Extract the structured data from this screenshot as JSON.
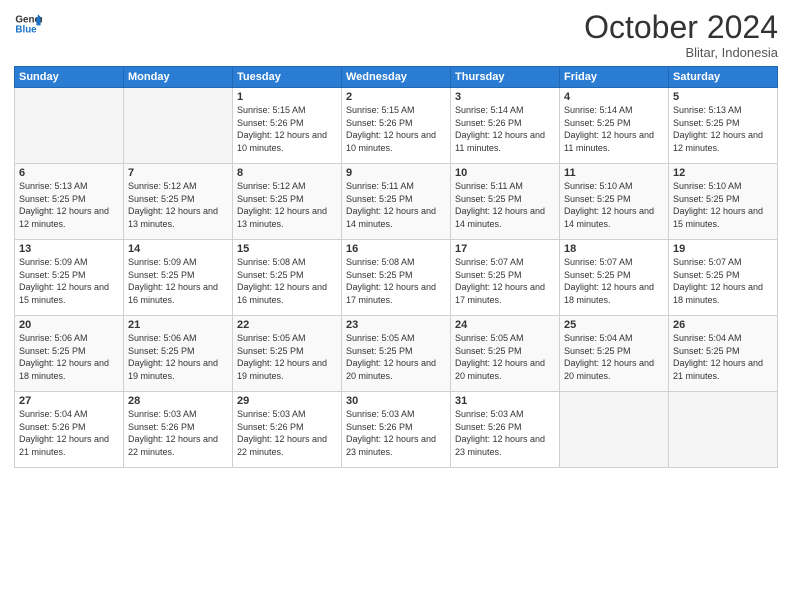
{
  "header": {
    "logo_line1": "General",
    "logo_line2": "Blue",
    "month": "October 2024",
    "location": "Blitar, Indonesia"
  },
  "weekdays": [
    "Sunday",
    "Monday",
    "Tuesday",
    "Wednesday",
    "Thursday",
    "Friday",
    "Saturday"
  ],
  "weeks": [
    [
      {
        "day": "",
        "empty": true
      },
      {
        "day": "",
        "empty": true
      },
      {
        "day": "1",
        "sunrise": "5:15 AM",
        "sunset": "5:26 PM",
        "daylight": "12 hours and 10 minutes."
      },
      {
        "day": "2",
        "sunrise": "5:15 AM",
        "sunset": "5:26 PM",
        "daylight": "12 hours and 10 minutes."
      },
      {
        "day": "3",
        "sunrise": "5:14 AM",
        "sunset": "5:26 PM",
        "daylight": "12 hours and 11 minutes."
      },
      {
        "day": "4",
        "sunrise": "5:14 AM",
        "sunset": "5:25 PM",
        "daylight": "12 hours and 11 minutes."
      },
      {
        "day": "5",
        "sunrise": "5:13 AM",
        "sunset": "5:25 PM",
        "daylight": "12 hours and 12 minutes."
      }
    ],
    [
      {
        "day": "6",
        "sunrise": "5:13 AM",
        "sunset": "5:25 PM",
        "daylight": "12 hours and 12 minutes."
      },
      {
        "day": "7",
        "sunrise": "5:12 AM",
        "sunset": "5:25 PM",
        "daylight": "12 hours and 13 minutes."
      },
      {
        "day": "8",
        "sunrise": "5:12 AM",
        "sunset": "5:25 PM",
        "daylight": "12 hours and 13 minutes."
      },
      {
        "day": "9",
        "sunrise": "5:11 AM",
        "sunset": "5:25 PM",
        "daylight": "12 hours and 14 minutes."
      },
      {
        "day": "10",
        "sunrise": "5:11 AM",
        "sunset": "5:25 PM",
        "daylight": "12 hours and 14 minutes."
      },
      {
        "day": "11",
        "sunrise": "5:10 AM",
        "sunset": "5:25 PM",
        "daylight": "12 hours and 14 minutes."
      },
      {
        "day": "12",
        "sunrise": "5:10 AM",
        "sunset": "5:25 PM",
        "daylight": "12 hours and 15 minutes."
      }
    ],
    [
      {
        "day": "13",
        "sunrise": "5:09 AM",
        "sunset": "5:25 PM",
        "daylight": "12 hours and 15 minutes."
      },
      {
        "day": "14",
        "sunrise": "5:09 AM",
        "sunset": "5:25 PM",
        "daylight": "12 hours and 16 minutes."
      },
      {
        "day": "15",
        "sunrise": "5:08 AM",
        "sunset": "5:25 PM",
        "daylight": "12 hours and 16 minutes."
      },
      {
        "day": "16",
        "sunrise": "5:08 AM",
        "sunset": "5:25 PM",
        "daylight": "12 hours and 17 minutes."
      },
      {
        "day": "17",
        "sunrise": "5:07 AM",
        "sunset": "5:25 PM",
        "daylight": "12 hours and 17 minutes."
      },
      {
        "day": "18",
        "sunrise": "5:07 AM",
        "sunset": "5:25 PM",
        "daylight": "12 hours and 18 minutes."
      },
      {
        "day": "19",
        "sunrise": "5:07 AM",
        "sunset": "5:25 PM",
        "daylight": "12 hours and 18 minutes."
      }
    ],
    [
      {
        "day": "20",
        "sunrise": "5:06 AM",
        "sunset": "5:25 PM",
        "daylight": "12 hours and 18 minutes."
      },
      {
        "day": "21",
        "sunrise": "5:06 AM",
        "sunset": "5:25 PM",
        "daylight": "12 hours and 19 minutes."
      },
      {
        "day": "22",
        "sunrise": "5:05 AM",
        "sunset": "5:25 PM",
        "daylight": "12 hours and 19 minutes."
      },
      {
        "day": "23",
        "sunrise": "5:05 AM",
        "sunset": "5:25 PM",
        "daylight": "12 hours and 20 minutes."
      },
      {
        "day": "24",
        "sunrise": "5:05 AM",
        "sunset": "5:25 PM",
        "daylight": "12 hours and 20 minutes."
      },
      {
        "day": "25",
        "sunrise": "5:04 AM",
        "sunset": "5:25 PM",
        "daylight": "12 hours and 20 minutes."
      },
      {
        "day": "26",
        "sunrise": "5:04 AM",
        "sunset": "5:25 PM",
        "daylight": "12 hours and 21 minutes."
      }
    ],
    [
      {
        "day": "27",
        "sunrise": "5:04 AM",
        "sunset": "5:26 PM",
        "daylight": "12 hours and 21 minutes."
      },
      {
        "day": "28",
        "sunrise": "5:03 AM",
        "sunset": "5:26 PM",
        "daylight": "12 hours and 22 minutes."
      },
      {
        "day": "29",
        "sunrise": "5:03 AM",
        "sunset": "5:26 PM",
        "daylight": "12 hours and 22 minutes."
      },
      {
        "day": "30",
        "sunrise": "5:03 AM",
        "sunset": "5:26 PM",
        "daylight": "12 hours and 23 minutes."
      },
      {
        "day": "31",
        "sunrise": "5:03 AM",
        "sunset": "5:26 PM",
        "daylight": "12 hours and 23 minutes."
      },
      {
        "day": "",
        "empty": true
      },
      {
        "day": "",
        "empty": true
      }
    ]
  ]
}
